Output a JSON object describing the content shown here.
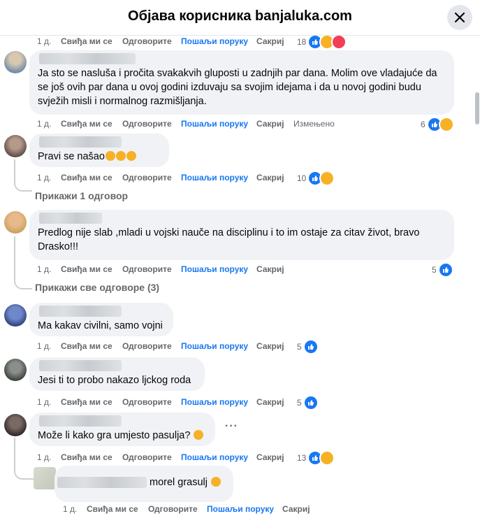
{
  "header": {
    "title": "Објава корисника banjaluka.com"
  },
  "labels": {
    "like": "Свиђа ми се",
    "reply": "Одговорите",
    "message": "Пошаљи поруку",
    "hide": "Сакриј",
    "edited": "Измењено"
  },
  "comments": [
    {
      "time": "1 д.",
      "reactions": "18"
    },
    {
      "time": "1 д.",
      "text": "Ja sto se nasluša i pročita svakakvih gluposti u zadnjih par dana. Molim ove vladajuće da\nse još ovih par dana u ovoj godini izduvaju sa svojim idejama i da u novoj godini budu\nsvježih misli i normalnog razmišljanja.",
      "reactions": "6"
    },
    {
      "time": "1 д.",
      "text": "Pravi se našao",
      "reactions": "10",
      "replies": "Прикажи 1 одговор"
    },
    {
      "time": "1 д.",
      "text": "Predlog nije slab ,mladi u vojski nauče na disciplinu i to im ostaje za citav život, bravo\nDrasko!!!",
      "reactions": "5",
      "replies": "Прикажи све одговоре (3)"
    },
    {
      "time": "1 д.",
      "text": "Ma kakav civilni, samo vojni",
      "reactions": "5"
    },
    {
      "time": "1 д.",
      "text": "Jesi ti to probo nakazo ljckog roda",
      "reactions": "5"
    },
    {
      "time": "1 д.",
      "text": "Može li kako gra umjesto pasulja?",
      "reactions": "13",
      "more": "···"
    },
    {
      "time": "1 д.",
      "text": "morel grasulj"
    }
  ],
  "colors": {
    "accent": "#1877f2",
    "bubble": "#f0f2f5",
    "muted": "#65676b"
  }
}
